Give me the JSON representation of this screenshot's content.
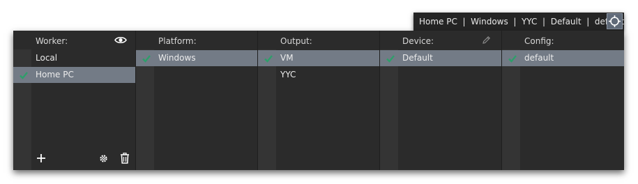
{
  "target_bar": {
    "summary": "Home PC  |  Windows  |  YYC  |  Default  |  default",
    "target_icon": "crosshair-icon"
  },
  "columns": {
    "worker": {
      "title": "Worker:",
      "header_icon": "eye-icon",
      "items": [
        {
          "label": "Local",
          "selected": false,
          "checked": false
        },
        {
          "label": "Home PC",
          "selected": true,
          "checked": true
        }
      ],
      "footer_icons": [
        "plus-icon",
        "gear-icon",
        "trash-icon"
      ]
    },
    "platform": {
      "title": "Platform:",
      "items": [
        {
          "label": "Windows",
          "selected": true,
          "checked": true
        }
      ]
    },
    "output": {
      "title": "Output:",
      "items": [
        {
          "label": "VM",
          "selected": true,
          "checked": true
        },
        {
          "label": "YYC",
          "selected": false,
          "checked": false
        }
      ]
    },
    "device": {
      "title": "Device:",
      "header_icon": "pencil-icon",
      "items": [
        {
          "label": "Default",
          "selected": true,
          "checked": true
        }
      ]
    },
    "config": {
      "title": "Config:",
      "items": [
        {
          "label": "default",
          "selected": true,
          "checked": true
        }
      ]
    }
  },
  "colors": {
    "panel_bg": "#2b2b2b",
    "gutter_bg": "#343434",
    "selected_bg": "#737b86",
    "check_green": "#2e9e6a"
  }
}
